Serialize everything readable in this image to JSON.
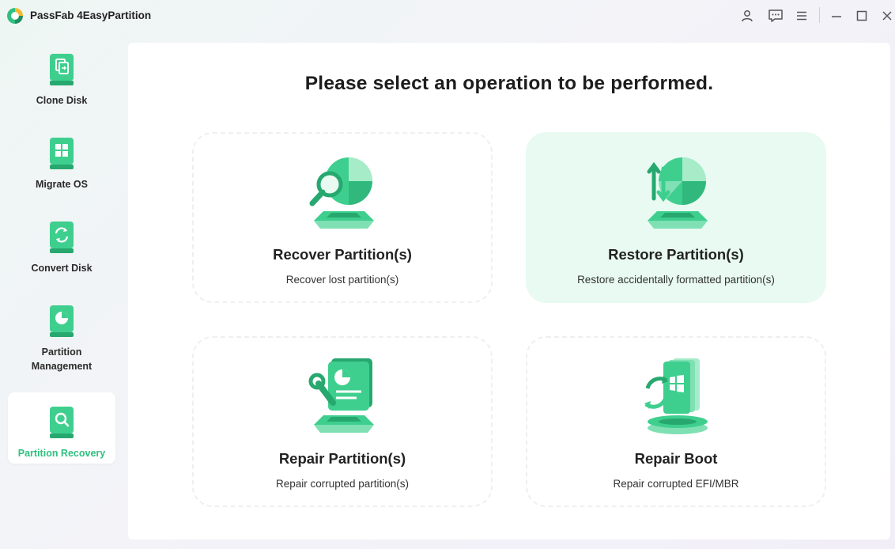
{
  "app": {
    "title": "PassFab 4EasyPartition"
  },
  "window_controls": {
    "account_icon": "user-icon",
    "feedback_icon": "chat-icon",
    "menu_icon": "menu-icon",
    "minimize_icon": "minimize-icon",
    "maximize_icon": "maximize-icon",
    "close_icon": "close-icon"
  },
  "sidebar": {
    "items": [
      {
        "label": "Clone Disk",
        "icon": "clone-disk-icon",
        "active": false
      },
      {
        "label": "Migrate OS",
        "icon": "migrate-os-icon",
        "active": false
      },
      {
        "label": "Convert Disk",
        "icon": "convert-disk-icon",
        "active": false
      },
      {
        "label": "Partition\nManagement",
        "icon": "partition-management-icon",
        "active": false
      },
      {
        "label": "Partition Recovery",
        "icon": "partition-recovery-icon",
        "active": true
      }
    ]
  },
  "main": {
    "title": "Please select an operation to be performed.",
    "cards": [
      {
        "title": "Recover Partition(s)",
        "description": "Recover lost partition(s)",
        "icon": "recover-partition-icon",
        "selected": false
      },
      {
        "title": "Restore Partition(s)",
        "description": "Restore accidentally formatted partition(s)",
        "icon": "restore-partition-icon",
        "selected": true
      },
      {
        "title": "Repair Partition(s)",
        "description": "Repair corrupted partition(s)",
        "icon": "repair-partition-icon",
        "selected": false
      },
      {
        "title": "Repair Boot",
        "description": "Repair corrupted EFI/MBR",
        "icon": "repair-boot-icon",
        "selected": false
      }
    ]
  },
  "colors": {
    "accent": "#2fbf7f",
    "accent_light": "#e8faf1",
    "icon_green": "#3ecf8e",
    "icon_dark_green": "#27a86f"
  }
}
